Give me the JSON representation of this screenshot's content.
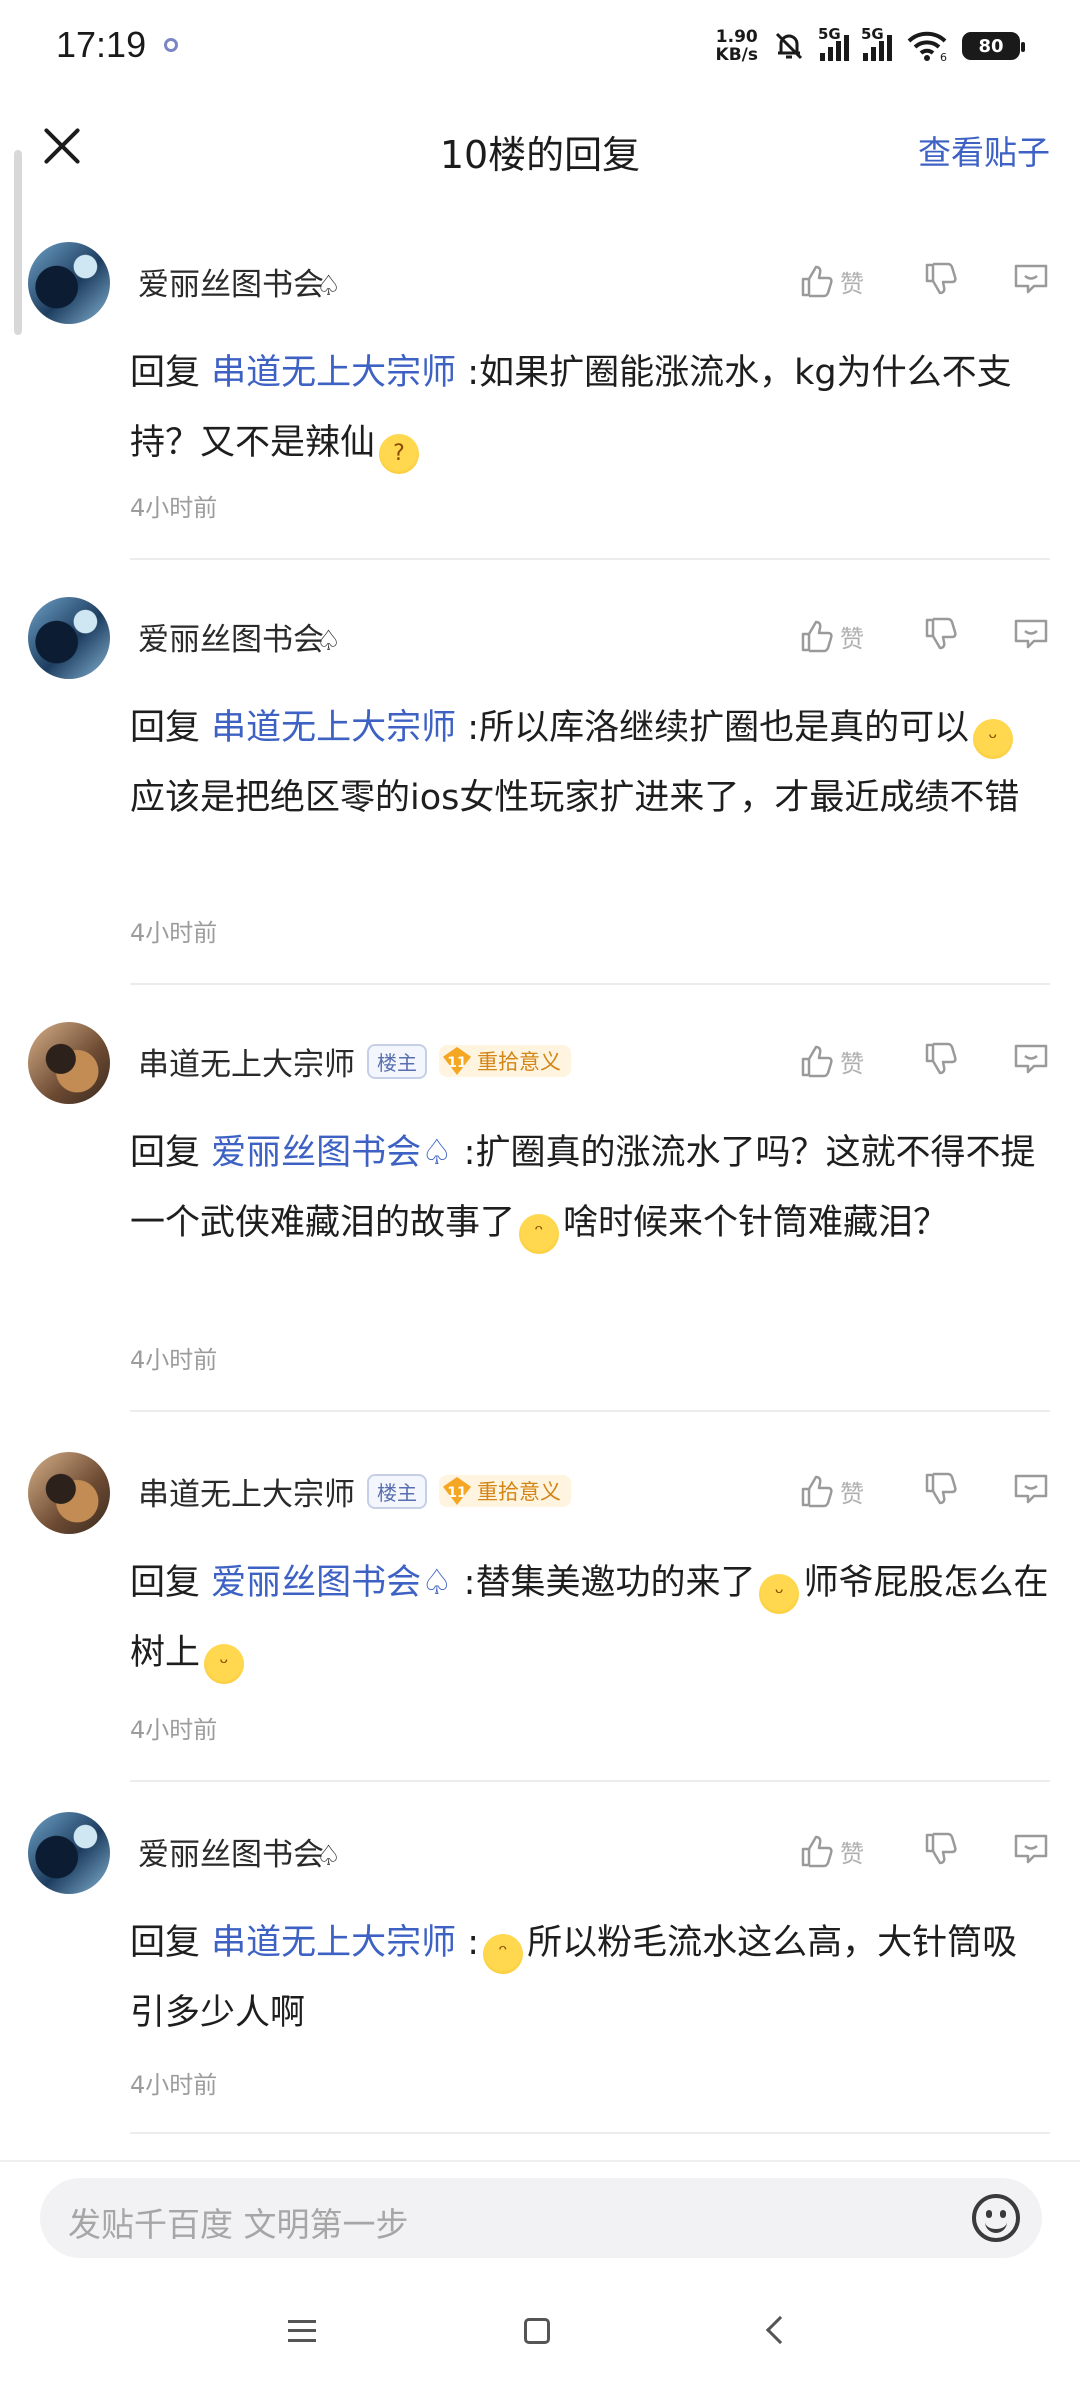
{
  "status_bar": {
    "time": "17:19",
    "net_speed_value": "1.90",
    "net_speed_unit": "KB/s",
    "signal_1_label": "5G",
    "signal_2_label": "5G",
    "wifi_label": "6",
    "battery_level": "80",
    "icons": [
      "notification-dot-icon",
      "mute-bell-icon",
      "signal-icon",
      "signal-icon",
      "wifi-icon",
      "battery-icon"
    ]
  },
  "header": {
    "title": "10楼的回复",
    "view_post_label": "查看贴子",
    "accent_color": "#3e62c4"
  },
  "replies": [
    {
      "author": "爱丽丝图书会",
      "suffix": "♤",
      "like_label": "赞",
      "reply_prefix": "回复",
      "reply_to": "串道无上大宗师",
      "sep": " :",
      "text_1": "如果扩圈能涨流水，kg为什么不支持？又不是辣仙",
      "time": "4小时前"
    },
    {
      "author": "爱丽丝图书会",
      "suffix": "♤",
      "like_label": "赞",
      "reply_prefix": "回复",
      "reply_to": "串道无上大宗师",
      "sep": " :",
      "text_1": "所以库洛继续扩圈也是真的可以",
      "text_2": "应该是把绝区零的ios女性玩家扩进来了，才最近成绩不错",
      "time": "4小时前"
    },
    {
      "author": "串道无上大宗师",
      "badge_lz": "楼主",
      "level": "11",
      "level_name": "重拾意义",
      "like_label": "赞",
      "reply_prefix": "回复",
      "reply_to": "爱丽丝图书会♤",
      "sep": " :",
      "text_1": "扩圈真的涨流水了吗？这就不得不提一个武侠难藏泪的故事了",
      "text_2": "啥时候来个针筒难藏泪？",
      "time": "4小时前"
    },
    {
      "author": "串道无上大宗师",
      "badge_lz": "楼主",
      "level": "11",
      "level_name": "重拾意义",
      "like_label": "赞",
      "reply_prefix": "回复",
      "reply_to": "爱丽丝图书会♤",
      "sep": " :",
      "text_1": "替集美邀功的来了",
      "text_2": "师爷屁股怎么在树上",
      "time": "4小时前"
    },
    {
      "author": "爱丽丝图书会",
      "suffix": "♤",
      "like_label": "赞",
      "reply_prefix": "回复",
      "reply_to": "串道无上大宗师",
      "sep": " :",
      "text_1": "所以粉毛流水这么高，大针筒吸引多少人啊",
      "time": "4小时前"
    }
  ],
  "input": {
    "placeholder": "发贴千百度 文明第一步"
  },
  "nav": {
    "icons": [
      "menu-icon",
      "home-icon",
      "back-icon"
    ]
  }
}
